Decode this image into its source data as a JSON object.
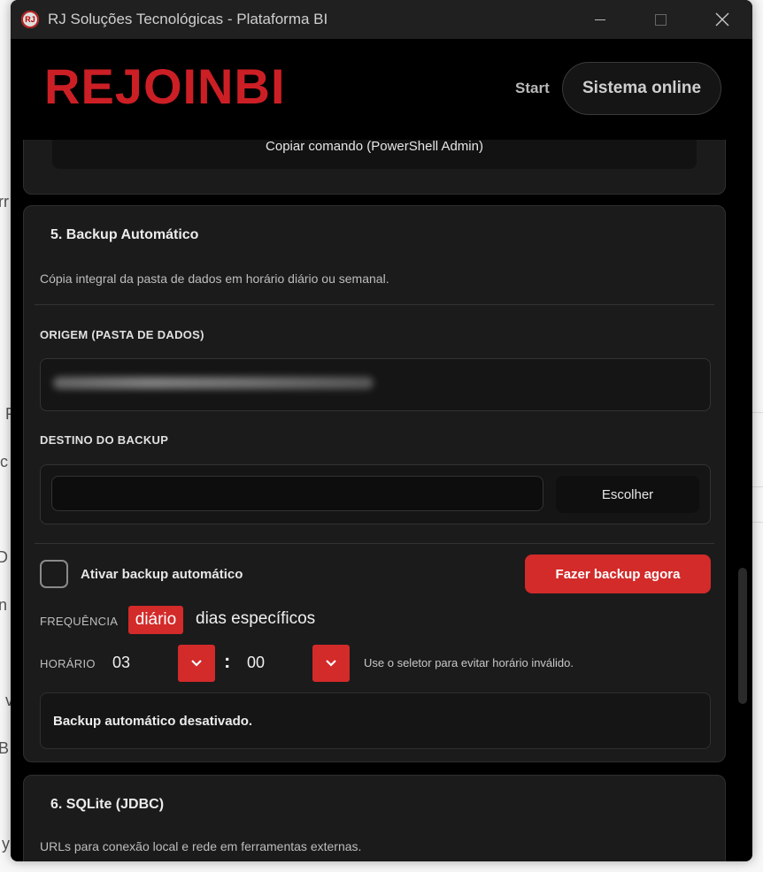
{
  "window": {
    "title": "RJ Soluções Tecnológicas - Plataforma BI",
    "icon_text": "RJ"
  },
  "header": {
    "logo_part1": "REJOIN",
    "logo_part2": "",
    "logo_part3": "BI",
    "nav_start": "Start",
    "status": "Sistema online"
  },
  "prev_card": {
    "copy_button": "Copiar comando (PowerShell Admin)"
  },
  "backup": {
    "title": "5. Backup Automático",
    "description": "Cópia integral da pasta de dados em horário diário ou semanal.",
    "origin_label": "ORIGEM (PASTA DE DADOS)",
    "destination_label": "DESTINO DO BACKUP",
    "destination_value": "",
    "choose_button": "Escolher",
    "auto_checkbox_label": "Ativar backup automático",
    "auto_enabled": false,
    "backup_now_button": "Fazer backup agora",
    "frequency_label": "FREQUÊNCIA",
    "frequency_options": [
      "diário",
      "dias específicos"
    ],
    "frequency_selected": "diário",
    "time_label": "HORÁRIO",
    "hour": "03",
    "minute": "00",
    "time_separator": ":",
    "time_hint": "Use o seletor para evitar horário inválido.",
    "status": "Backup automático desativado."
  },
  "sqlite": {
    "title": "6. SQLite (JDBC)",
    "description": "URLs para conexão local e rede em ferramentas externas."
  },
  "colors": {
    "accent": "#d32a2a",
    "background": "#000000",
    "card": "#1b1b1b"
  },
  "icons": {
    "close": "close-icon",
    "minimize": "minimize-icon",
    "maximize": "maximize-icon",
    "chevron": "chevron-down-icon"
  }
}
